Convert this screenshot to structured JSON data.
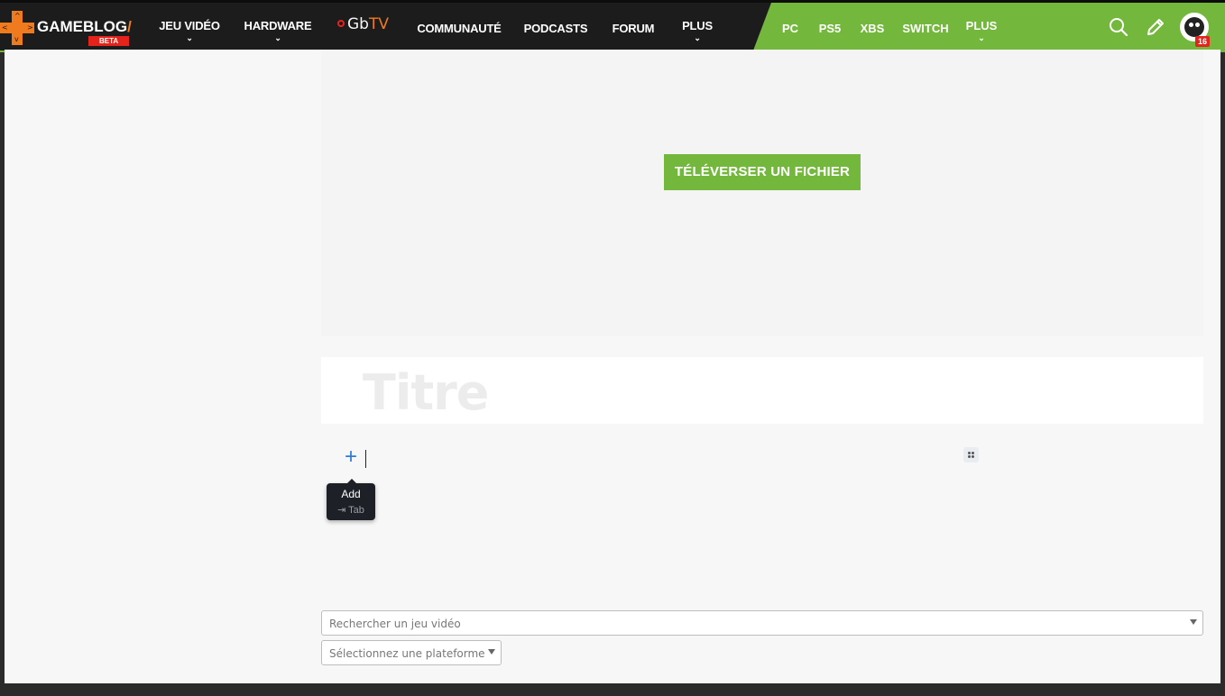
{
  "brand": {
    "name": "GAMEBLOG",
    "slash": "/",
    "beta": "BETA",
    "colors": {
      "orange": "#f07b1f",
      "green": "#73b83c",
      "red": "#e5231b",
      "dark": "#1c1c1c"
    }
  },
  "nav": {
    "items": [
      {
        "label": "JEU VIDÉO",
        "has_dropdown": true
      },
      {
        "label": "HARDWARE",
        "has_dropdown": true
      },
      {
        "label": "COMMUNAUTÉ",
        "has_dropdown": false
      },
      {
        "label": "PODCASTS",
        "has_dropdown": false
      },
      {
        "label": "FORUM",
        "has_dropdown": false
      },
      {
        "label": "PLUS",
        "has_dropdown": true
      }
    ],
    "gbtv": {
      "gb": "Gb",
      "tv": "TV"
    },
    "chevron": "⌄"
  },
  "platforms": {
    "items": [
      {
        "label": "PC"
      },
      {
        "label": "PS5"
      },
      {
        "label": "XBS"
      },
      {
        "label": "SWITCH"
      },
      {
        "label": "PLUS"
      }
    ]
  },
  "header_icons": [
    "search-icon",
    "pencil-icon",
    "avatar"
  ],
  "user": {
    "notification_count": "16"
  },
  "editor": {
    "upload_button": "TÉLÉVERSER UN FICHIER",
    "title_placeholder": "Titre",
    "add_tooltip": {
      "label": "Add",
      "shortcut": "⇥ Tab"
    }
  },
  "form": {
    "game_search_placeholder": "Rechercher un jeu vidéo",
    "platform_placeholder": "Sélectionnez une plateforme"
  }
}
